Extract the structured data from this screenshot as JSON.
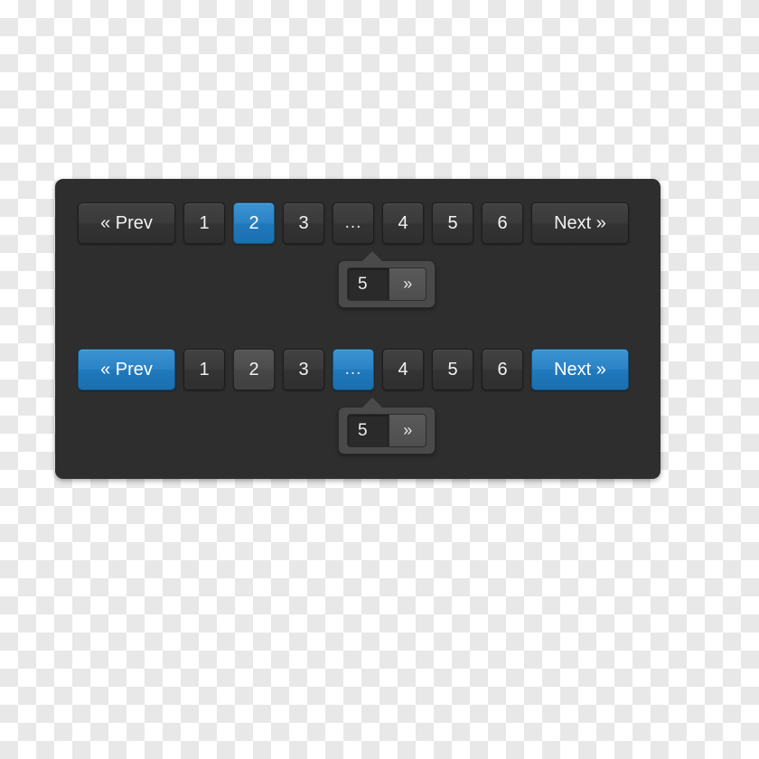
{
  "panel": {
    "background_color": "#2e2e2e",
    "accent_color": "#2b82c4"
  },
  "pagers": [
    {
      "name": "pagination-default",
      "items": [
        {
          "label": "« Prev",
          "state": "normal",
          "kind": "prev"
        },
        {
          "label": "1",
          "state": "normal",
          "kind": "page"
        },
        {
          "label": "2",
          "state": "active",
          "kind": "page"
        },
        {
          "label": "3",
          "state": "normal",
          "kind": "page"
        },
        {
          "label": "...",
          "state": "normal",
          "kind": "ellipsis"
        },
        {
          "label": "4",
          "state": "normal",
          "kind": "page"
        },
        {
          "label": "5",
          "state": "normal",
          "kind": "page"
        },
        {
          "label": "6",
          "state": "normal",
          "kind": "page"
        },
        {
          "label": "Next »",
          "state": "normal",
          "kind": "next"
        }
      ],
      "popover": {
        "input_value": "5",
        "input_placeholder": "5",
        "go_label": "»"
      }
    },
    {
      "name": "pagination-hover",
      "items": [
        {
          "label": "« Prev",
          "state": "primary",
          "kind": "prev"
        },
        {
          "label": "1",
          "state": "normal",
          "kind": "page"
        },
        {
          "label": "2",
          "state": "hover",
          "kind": "page"
        },
        {
          "label": "3",
          "state": "normal",
          "kind": "page"
        },
        {
          "label": "...",
          "state": "primary",
          "kind": "ellipsis"
        },
        {
          "label": "4",
          "state": "normal",
          "kind": "page"
        },
        {
          "label": "5",
          "state": "normal",
          "kind": "page"
        },
        {
          "label": "6",
          "state": "normal",
          "kind": "page"
        },
        {
          "label": "Next »",
          "state": "primary",
          "kind": "next"
        }
      ],
      "popover": {
        "input_value": "5",
        "input_placeholder": "5",
        "go_label": "»"
      }
    }
  ]
}
